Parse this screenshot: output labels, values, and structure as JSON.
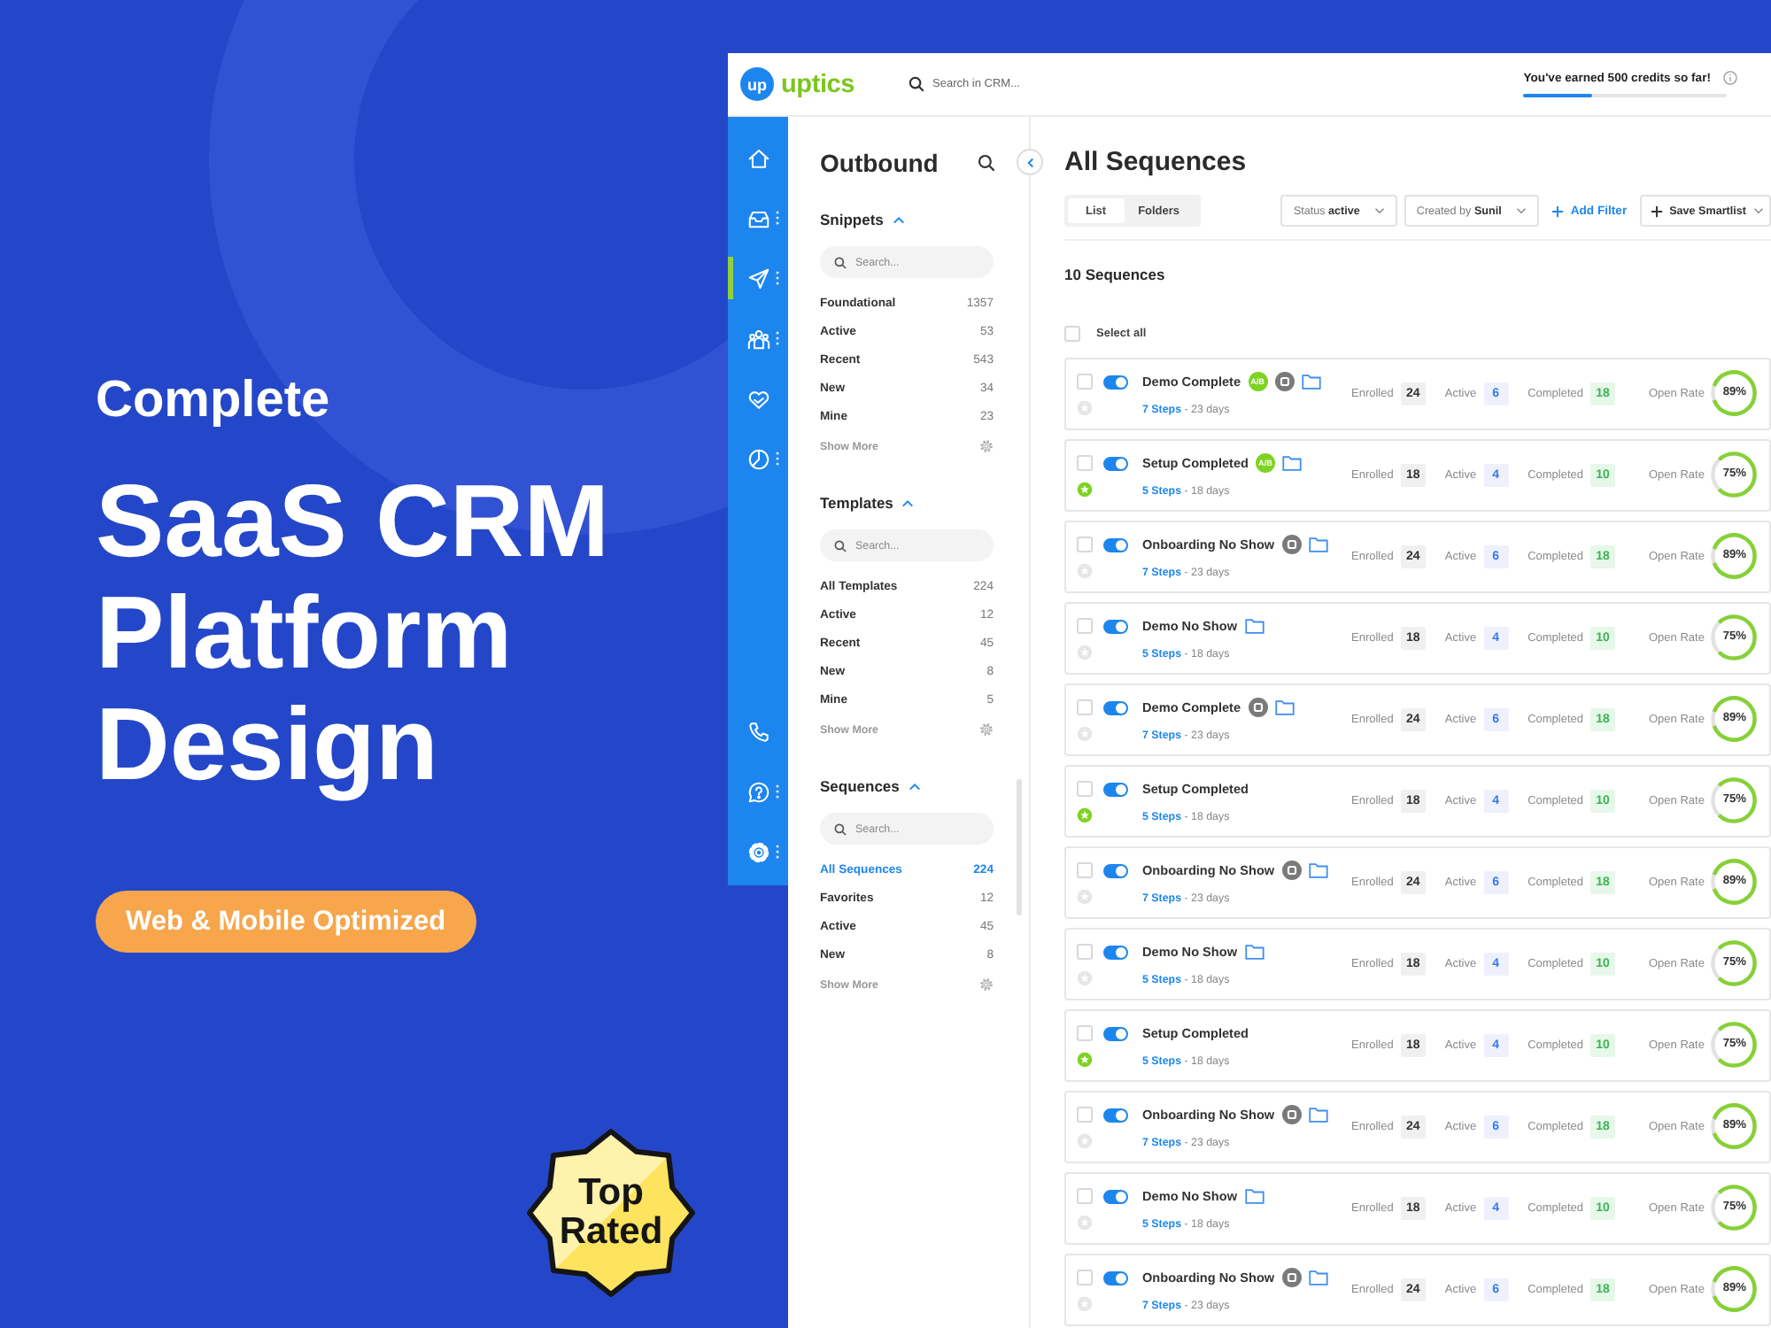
{
  "promo": {
    "eyebrow": "Complete",
    "headline": "SaaS CRM Platform Design",
    "pill": "Web & Mobile Optimized",
    "badge": "Top Rated"
  },
  "topbar": {
    "logo_mark": "up",
    "logo_name": "uptics",
    "search": {
      "placeholder": "Search in CRM..."
    },
    "credits": {
      "text": "You've earned 500 credits so far!",
      "level": 0.34
    }
  },
  "nav": {
    "top_items": [
      {
        "selected": false,
        "menu": false
      },
      {
        "selected": false,
        "menu": true
      },
      {
        "selected": true,
        "menu": true
      },
      {
        "selected": false,
        "menu": true
      },
      {
        "selected": false,
        "menu": false
      },
      {
        "selected": false,
        "menu": true
      }
    ],
    "bottom_items": [
      {
        "selected": false,
        "menu": false
      },
      {
        "selected": false,
        "menu": true
      },
      {
        "selected": false,
        "menu": true
      }
    ]
  },
  "outbound": {
    "title": "Outbound",
    "sections": [
      {
        "title": "Snippets",
        "expanded": true,
        "search": {
          "placeholder": "Search..."
        },
        "items": [
          {
            "label": "Foundational",
            "count": "1357",
            "selected": false
          },
          {
            "label": "Active",
            "count": "53",
            "selected": false
          },
          {
            "label": "Recent",
            "count": "543",
            "selected": false
          },
          {
            "label": "New",
            "count": "34",
            "selected": false
          },
          {
            "label": "Mine",
            "count": "23",
            "selected": false
          }
        ],
        "show_more": "Show More"
      },
      {
        "title": "Templates",
        "expanded": true,
        "search": {
          "placeholder": "Search..."
        },
        "items": [
          {
            "label": "All Templates",
            "count": "224",
            "selected": false
          },
          {
            "label": "Active",
            "count": "12",
            "selected": false
          },
          {
            "label": "Recent",
            "count": "45",
            "selected": false
          },
          {
            "label": "New",
            "count": "8",
            "selected": false
          },
          {
            "label": "Mine",
            "count": "5",
            "selected": false
          }
        ],
        "show_more": "Show More"
      },
      {
        "title": "Sequences",
        "expanded": true,
        "search": {
          "placeholder": "Search..."
        },
        "items": [
          {
            "label": "All Sequences",
            "count": "224",
            "selected": true
          },
          {
            "label": "Favorites",
            "count": "12",
            "selected": false
          },
          {
            "label": "Active",
            "count": "45",
            "selected": false
          },
          {
            "label": "New",
            "count": "8",
            "selected": false
          }
        ],
        "show_more": "Show More"
      }
    ]
  },
  "main": {
    "title": "All Sequences",
    "tabs": [
      {
        "label": "List",
        "selected": true
      },
      {
        "label": "Folders",
        "selected": false
      }
    ],
    "filters": [
      {
        "label": "Status **active**"
      },
      {
        "label": "Created by **Sunil**"
      }
    ],
    "add_filter": "Add Filter",
    "save_smartlist": "Save Smartlist",
    "count": "10 Sequences",
    "select_all": {
      "label": "Select all",
      "checked": false
    },
    "rows": [
      {
        "name": "Demo Complete",
        "badges": [
          {
            "kind": "ab",
            "label": "A/B"
          },
          {
            "kind": "stop"
          },
          {
            "kind": "folder"
          }
        ],
        "meta": "**7 Steps** - 23 days",
        "checked": false,
        "on": true,
        "favorite": false,
        "stats": [
          {
            "kind": "enrolled",
            "label": "Enrolled",
            "value": "24"
          },
          {
            "kind": "active",
            "label": "Active",
            "value": "6"
          },
          {
            "kind": "completed",
            "label": "Completed",
            "value": "18"
          },
          {
            "kind": "rate",
            "label": "Open Rate",
            "value": "89%",
            "level": 0.89
          }
        ]
      },
      {
        "name": "Setup Completed",
        "badges": [
          {
            "kind": "ab",
            "label": "A/B"
          },
          {
            "kind": "folder"
          }
        ],
        "meta": "**5 Steps** - 18 days",
        "checked": false,
        "on": true,
        "favorite": true,
        "stats": [
          {
            "kind": "enrolled",
            "label": "Enrolled",
            "value": "18"
          },
          {
            "kind": "active",
            "label": "Active",
            "value": "4"
          },
          {
            "kind": "completed",
            "label": "Completed",
            "value": "10"
          },
          {
            "kind": "rate",
            "label": "Open Rate",
            "value": "75%",
            "level": 0.75
          }
        ]
      },
      {
        "name": "Onboarding No Show",
        "badges": [
          {
            "kind": "stop"
          },
          {
            "kind": "folder"
          }
        ],
        "meta": "**7 Steps** - 23 days",
        "checked": false,
        "on": true,
        "favorite": false,
        "stats": [
          {
            "kind": "enrolled",
            "label": "Enrolled",
            "value": "24"
          },
          {
            "kind": "active",
            "label": "Active",
            "value": "6"
          },
          {
            "kind": "completed",
            "label": "Completed",
            "value": "18"
          },
          {
            "kind": "rate",
            "label": "Open Rate",
            "value": "89%",
            "level": 0.89
          }
        ]
      },
      {
        "name": "Demo No Show",
        "badges": [
          {
            "kind": "folder"
          }
        ],
        "meta": "**5 Steps** - 18 days",
        "checked": false,
        "on": true,
        "favorite": false,
        "stats": [
          {
            "kind": "enrolled",
            "label": "Enrolled",
            "value": "18"
          },
          {
            "kind": "active",
            "label": "Active",
            "value": "4"
          },
          {
            "kind": "completed",
            "label": "Completed",
            "value": "10"
          },
          {
            "kind": "rate",
            "label": "Open Rate",
            "value": "75%",
            "level": 0.75
          }
        ]
      },
      {
        "name": "Demo Complete",
        "badges": [
          {
            "kind": "stop"
          },
          {
            "kind": "folder"
          }
        ],
        "meta": "**7 Steps** - 23 days",
        "checked": false,
        "on": true,
        "favorite": false,
        "stats": [
          {
            "kind": "enrolled",
            "label": "Enrolled",
            "value": "24"
          },
          {
            "kind": "active",
            "label": "Active",
            "value": "6"
          },
          {
            "kind": "completed",
            "label": "Completed",
            "value": "18"
          },
          {
            "kind": "rate",
            "label": "Open Rate",
            "value": "89%",
            "level": 0.89
          }
        ]
      },
      {
        "name": "Setup Completed",
        "meta": "**5 Steps** - 18 days",
        "checked": false,
        "on": true,
        "favorite": true,
        "stats": [
          {
            "kind": "enrolled",
            "label": "Enrolled",
            "value": "18"
          },
          {
            "kind": "active",
            "label": "Active",
            "value": "4"
          },
          {
            "kind": "completed",
            "label": "Completed",
            "value": "10"
          },
          {
            "kind": "rate",
            "label": "Open Rate",
            "value": "75%",
            "level": 0.75
          }
        ]
      },
      {
        "name": "Onboarding No Show",
        "badges": [
          {
            "kind": "stop"
          },
          {
            "kind": "folder"
          }
        ],
        "meta": "**7 Steps** - 23 days",
        "checked": false,
        "on": true,
        "favorite": false,
        "stats": [
          {
            "kind": "enrolled",
            "label": "Enrolled",
            "value": "24"
          },
          {
            "kind": "active",
            "label": "Active",
            "value": "6"
          },
          {
            "kind": "completed",
            "label": "Completed",
            "value": "18"
          },
          {
            "kind": "rate",
            "label": "Open Rate",
            "value": "89%",
            "level": 0.89
          }
        ]
      },
      {
        "name": "Demo No Show",
        "badges": [
          {
            "kind": "folder"
          }
        ],
        "meta": "**5 Steps** - 18 days",
        "checked": false,
        "on": true,
        "favorite": false,
        "stats": [
          {
            "kind": "enrolled",
            "label": "Enrolled",
            "value": "18"
          },
          {
            "kind": "active",
            "label": "Active",
            "value": "4"
          },
          {
            "kind": "completed",
            "label": "Completed",
            "value": "10"
          },
          {
            "kind": "rate",
            "label": "Open Rate",
            "value": "75%",
            "level": 0.75
          }
        ]
      },
      {
        "name": "Setup Completed",
        "meta": "**5 Steps** - 18 days",
        "checked": false,
        "on": true,
        "favorite": true,
        "stats": [
          {
            "kind": "enrolled",
            "label": "Enrolled",
            "value": "18"
          },
          {
            "kind": "active",
            "label": "Active",
            "value": "4"
          },
          {
            "kind": "completed",
            "label": "Completed",
            "value": "10"
          },
          {
            "kind": "rate",
            "label": "Open Rate",
            "value": "75%",
            "level": 0.75
          }
        ]
      },
      {
        "name": "Onboarding No Show",
        "badges": [
          {
            "kind": "stop"
          },
          {
            "kind": "folder"
          }
        ],
        "meta": "**7 Steps** - 23 days",
        "checked": false,
        "on": true,
        "favorite": false,
        "stats": [
          {
            "kind": "enrolled",
            "label": "Enrolled",
            "value": "24"
          },
          {
            "kind": "active",
            "label": "Active",
            "value": "6"
          },
          {
            "kind": "completed",
            "label": "Completed",
            "value": "18"
          },
          {
            "kind": "rate",
            "label": "Open Rate",
            "value": "89%",
            "level": 0.89
          }
        ]
      },
      {
        "name": "Demo No Show",
        "badges": [
          {
            "kind": "folder"
          }
        ],
        "meta": "**5 Steps** - 18 days",
        "checked": false,
        "on": true,
        "favorite": false,
        "stats": [
          {
            "kind": "enrolled",
            "label": "Enrolled",
            "value": "18"
          },
          {
            "kind": "active",
            "label": "Active",
            "value": "4"
          },
          {
            "kind": "completed",
            "label": "Completed",
            "value": "10"
          },
          {
            "kind": "rate",
            "label": "Open Rate",
            "value": "75%",
            "level": 0.75
          }
        ]
      },
      {
        "name": "Onboarding No Show",
        "badges": [
          {
            "kind": "stop"
          },
          {
            "kind": "folder"
          }
        ],
        "meta": "**7 Steps** - 23 days",
        "checked": false,
        "on": true,
        "favorite": false,
        "stats": [
          {
            "kind": "enrolled",
            "label": "Enrolled",
            "value": "24"
          },
          {
            "kind": "active",
            "label": "Active",
            "value": "6"
          },
          {
            "kind": "completed",
            "label": "Completed",
            "value": "18"
          },
          {
            "kind": "rate",
            "label": "Open Rate",
            "value": "89%",
            "level": 0.89
          }
        ]
      }
    ]
  }
}
